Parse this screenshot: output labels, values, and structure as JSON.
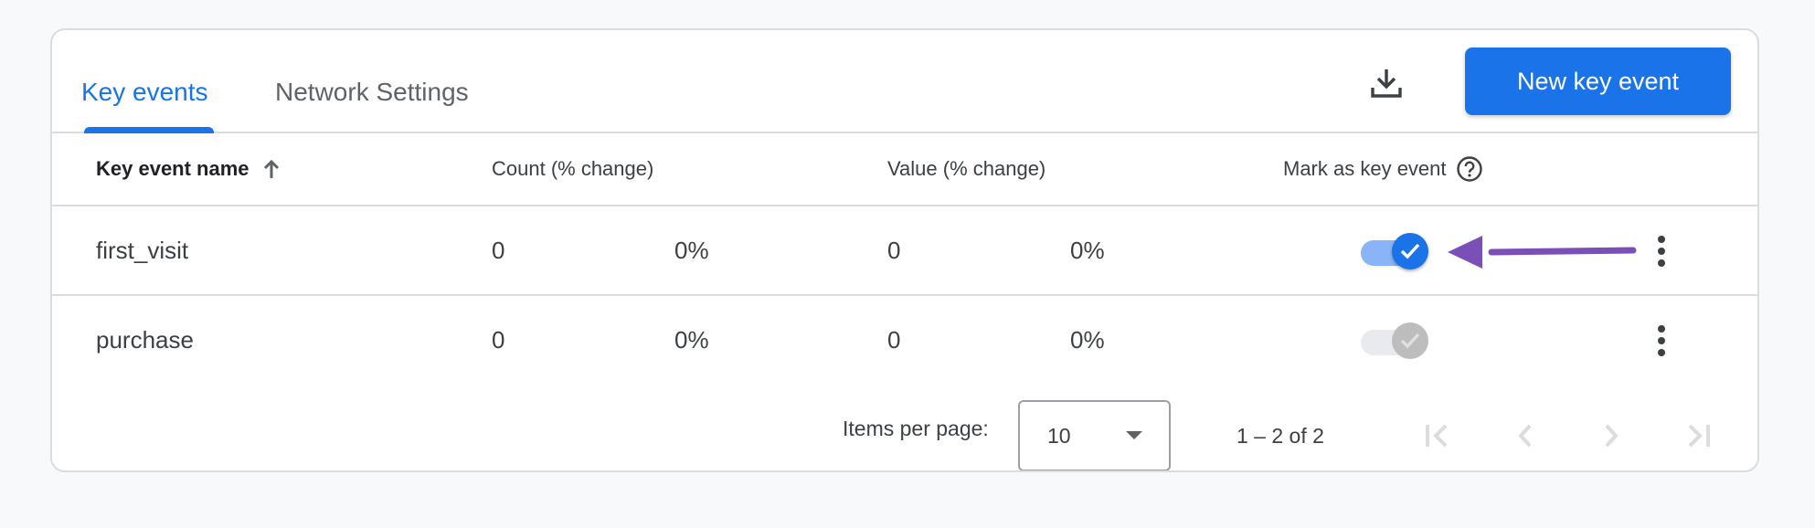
{
  "tabs": [
    {
      "label": "Key events",
      "active": true
    },
    {
      "label": "Network Settings",
      "active": false
    }
  ],
  "toolbar": {
    "download_icon": "download-icon",
    "new_button_label": "New key event"
  },
  "table": {
    "columns": [
      {
        "label": "Key event name",
        "sort": "ascending",
        "icon": "arrow-upward-icon"
      },
      {
        "label": "Count (% change)"
      },
      {
        "label": "Value (% change)"
      },
      {
        "label": "Mark as key event",
        "icon": "help-circle-icon"
      }
    ],
    "rows": [
      {
        "name": "first_visit",
        "count": "0",
        "count_change": "0%",
        "value": "0",
        "value_change": "0%",
        "mark_as_key_event": true,
        "toggle_enabled": true
      },
      {
        "name": "purchase",
        "count": "0",
        "count_change": "0%",
        "value": "0",
        "value_change": "0%",
        "mark_as_key_event": true,
        "toggle_enabled": false
      }
    ]
  },
  "annotation": {
    "type": "arrow",
    "points_to": "first_visit mark-as-key-event toggle",
    "color": "#7b4fb8"
  },
  "pagination": {
    "items_per_page_label": "Items per page:",
    "items_per_page_value": "10",
    "range_label": "1 – 2 of 2",
    "buttons": [
      "first-page",
      "previous-page",
      "next-page",
      "last-page"
    ]
  },
  "colors": {
    "accent": "#1a73e8",
    "toggle_track_on": "#8ab4f8",
    "toggle_disabled": "#bdbdbd",
    "divider": "#dadce0",
    "page_background": "#f8f9fa"
  }
}
